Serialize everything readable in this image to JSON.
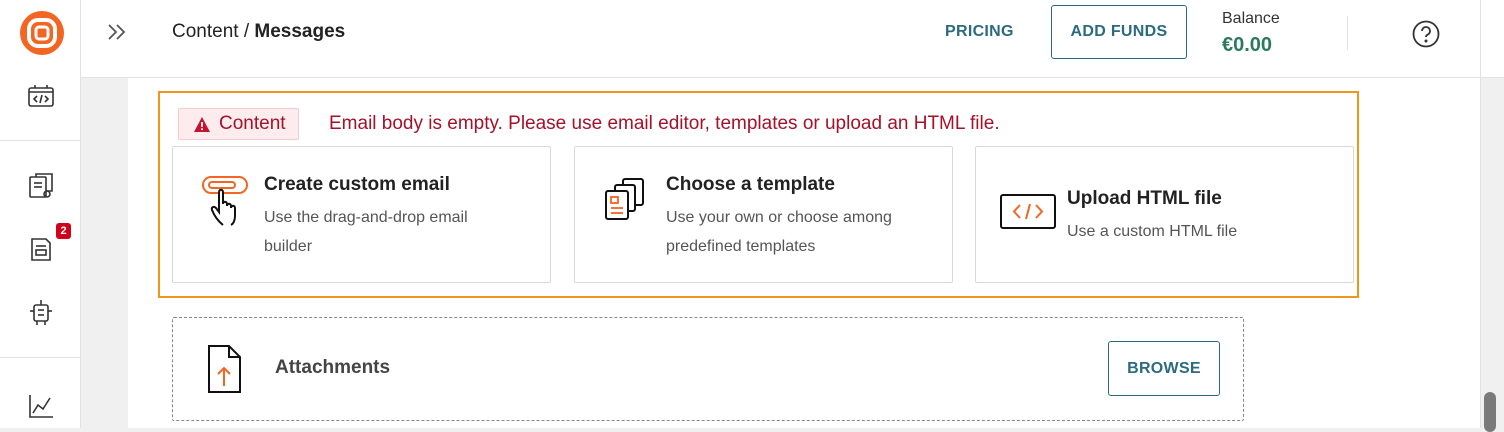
{
  "breadcrumb": {
    "section": "Content",
    "separator": " / ",
    "page": "Messages"
  },
  "header": {
    "pricing_label": "PRICING",
    "add_funds_label": "ADD FUNDS",
    "balance_label": "Balance",
    "balance_value": "€0.00"
  },
  "sidebar": {
    "notifications_badge": "2"
  },
  "error": {
    "tag_label": "Content",
    "message": "Email body is empty. Please use email editor, templates or upload an HTML file."
  },
  "options": [
    {
      "title": "Create custom email",
      "desc_line1": "Use the drag-and-drop email",
      "desc_line2": "builder"
    },
    {
      "title": "Choose a template",
      "desc_line1": "Use your own or choose among",
      "desc_line2": "predefined templates"
    },
    {
      "title": "Upload HTML file",
      "desc_line1": "Use a custom HTML file"
    }
  ],
  "attachments": {
    "title": "Attachments",
    "browse_label": "BROWSE"
  },
  "colors": {
    "accent": "#2c6a80",
    "brand": "#f26522",
    "error": "#a4122a",
    "warning_border": "#f0961e",
    "balance": "#2c7a5e"
  }
}
